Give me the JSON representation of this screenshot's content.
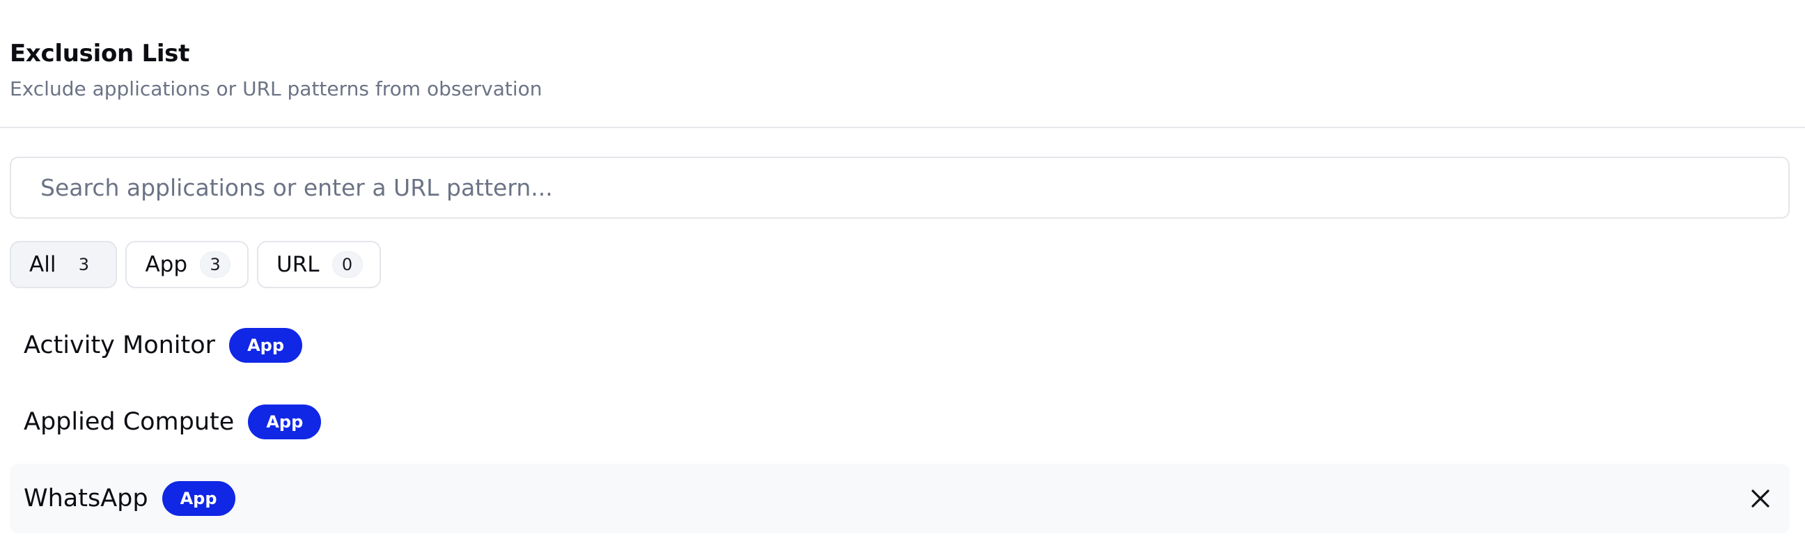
{
  "header": {
    "title": "Exclusion List",
    "subtitle": "Exclude applications or URL patterns from observation"
  },
  "search": {
    "placeholder": "Search applications or enter a URL pattern...",
    "value": ""
  },
  "filters": [
    {
      "label": "All",
      "count": "3",
      "active": true
    },
    {
      "label": "App",
      "count": "3",
      "active": false
    },
    {
      "label": "URL",
      "count": "0",
      "active": false
    }
  ],
  "items": [
    {
      "name": "Activity Monitor",
      "type": "App"
    },
    {
      "name": "Applied Compute",
      "type": "App"
    },
    {
      "name": "WhatsApp",
      "type": "App"
    }
  ],
  "icons": {
    "remove": "close-icon"
  },
  "colors": {
    "badge_bg": "#1027e6",
    "subtitle_text": "#6b7385",
    "hover_row_bg": "#f7f9fb"
  }
}
